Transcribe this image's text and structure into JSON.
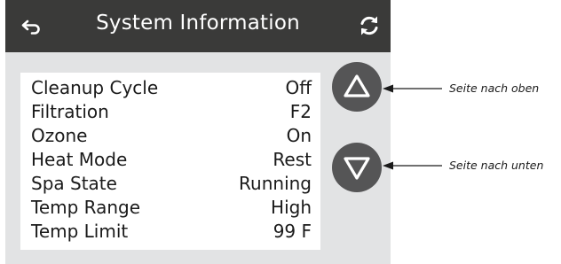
{
  "header": {
    "title": "System Information",
    "back_icon": "back-arrow-icon",
    "refresh_icon": "refresh-icon"
  },
  "info": {
    "rows": [
      {
        "label": "Cleanup Cycle",
        "value": "Off"
      },
      {
        "label": "Filtration",
        "value": "F2"
      },
      {
        "label": "Ozone",
        "value": "On"
      },
      {
        "label": "Heat Mode",
        "value": "Rest"
      },
      {
        "label": "Spa State",
        "value": "Running"
      },
      {
        "label": "Temp Range",
        "value": "High"
      },
      {
        "label": "Temp Limit",
        "value": "99 F"
      }
    ]
  },
  "nav": {
    "up_icon": "triangle-up-icon",
    "down_icon": "triangle-down-icon"
  },
  "annotations": {
    "page_up": "Seite nach oben",
    "page_down": "Seite nach unten"
  },
  "colors": {
    "header_bg": "#3a3a39",
    "screen_bg": "#e2e3e4",
    "panel_bg": "#ffffff",
    "button_bg": "#555556"
  }
}
